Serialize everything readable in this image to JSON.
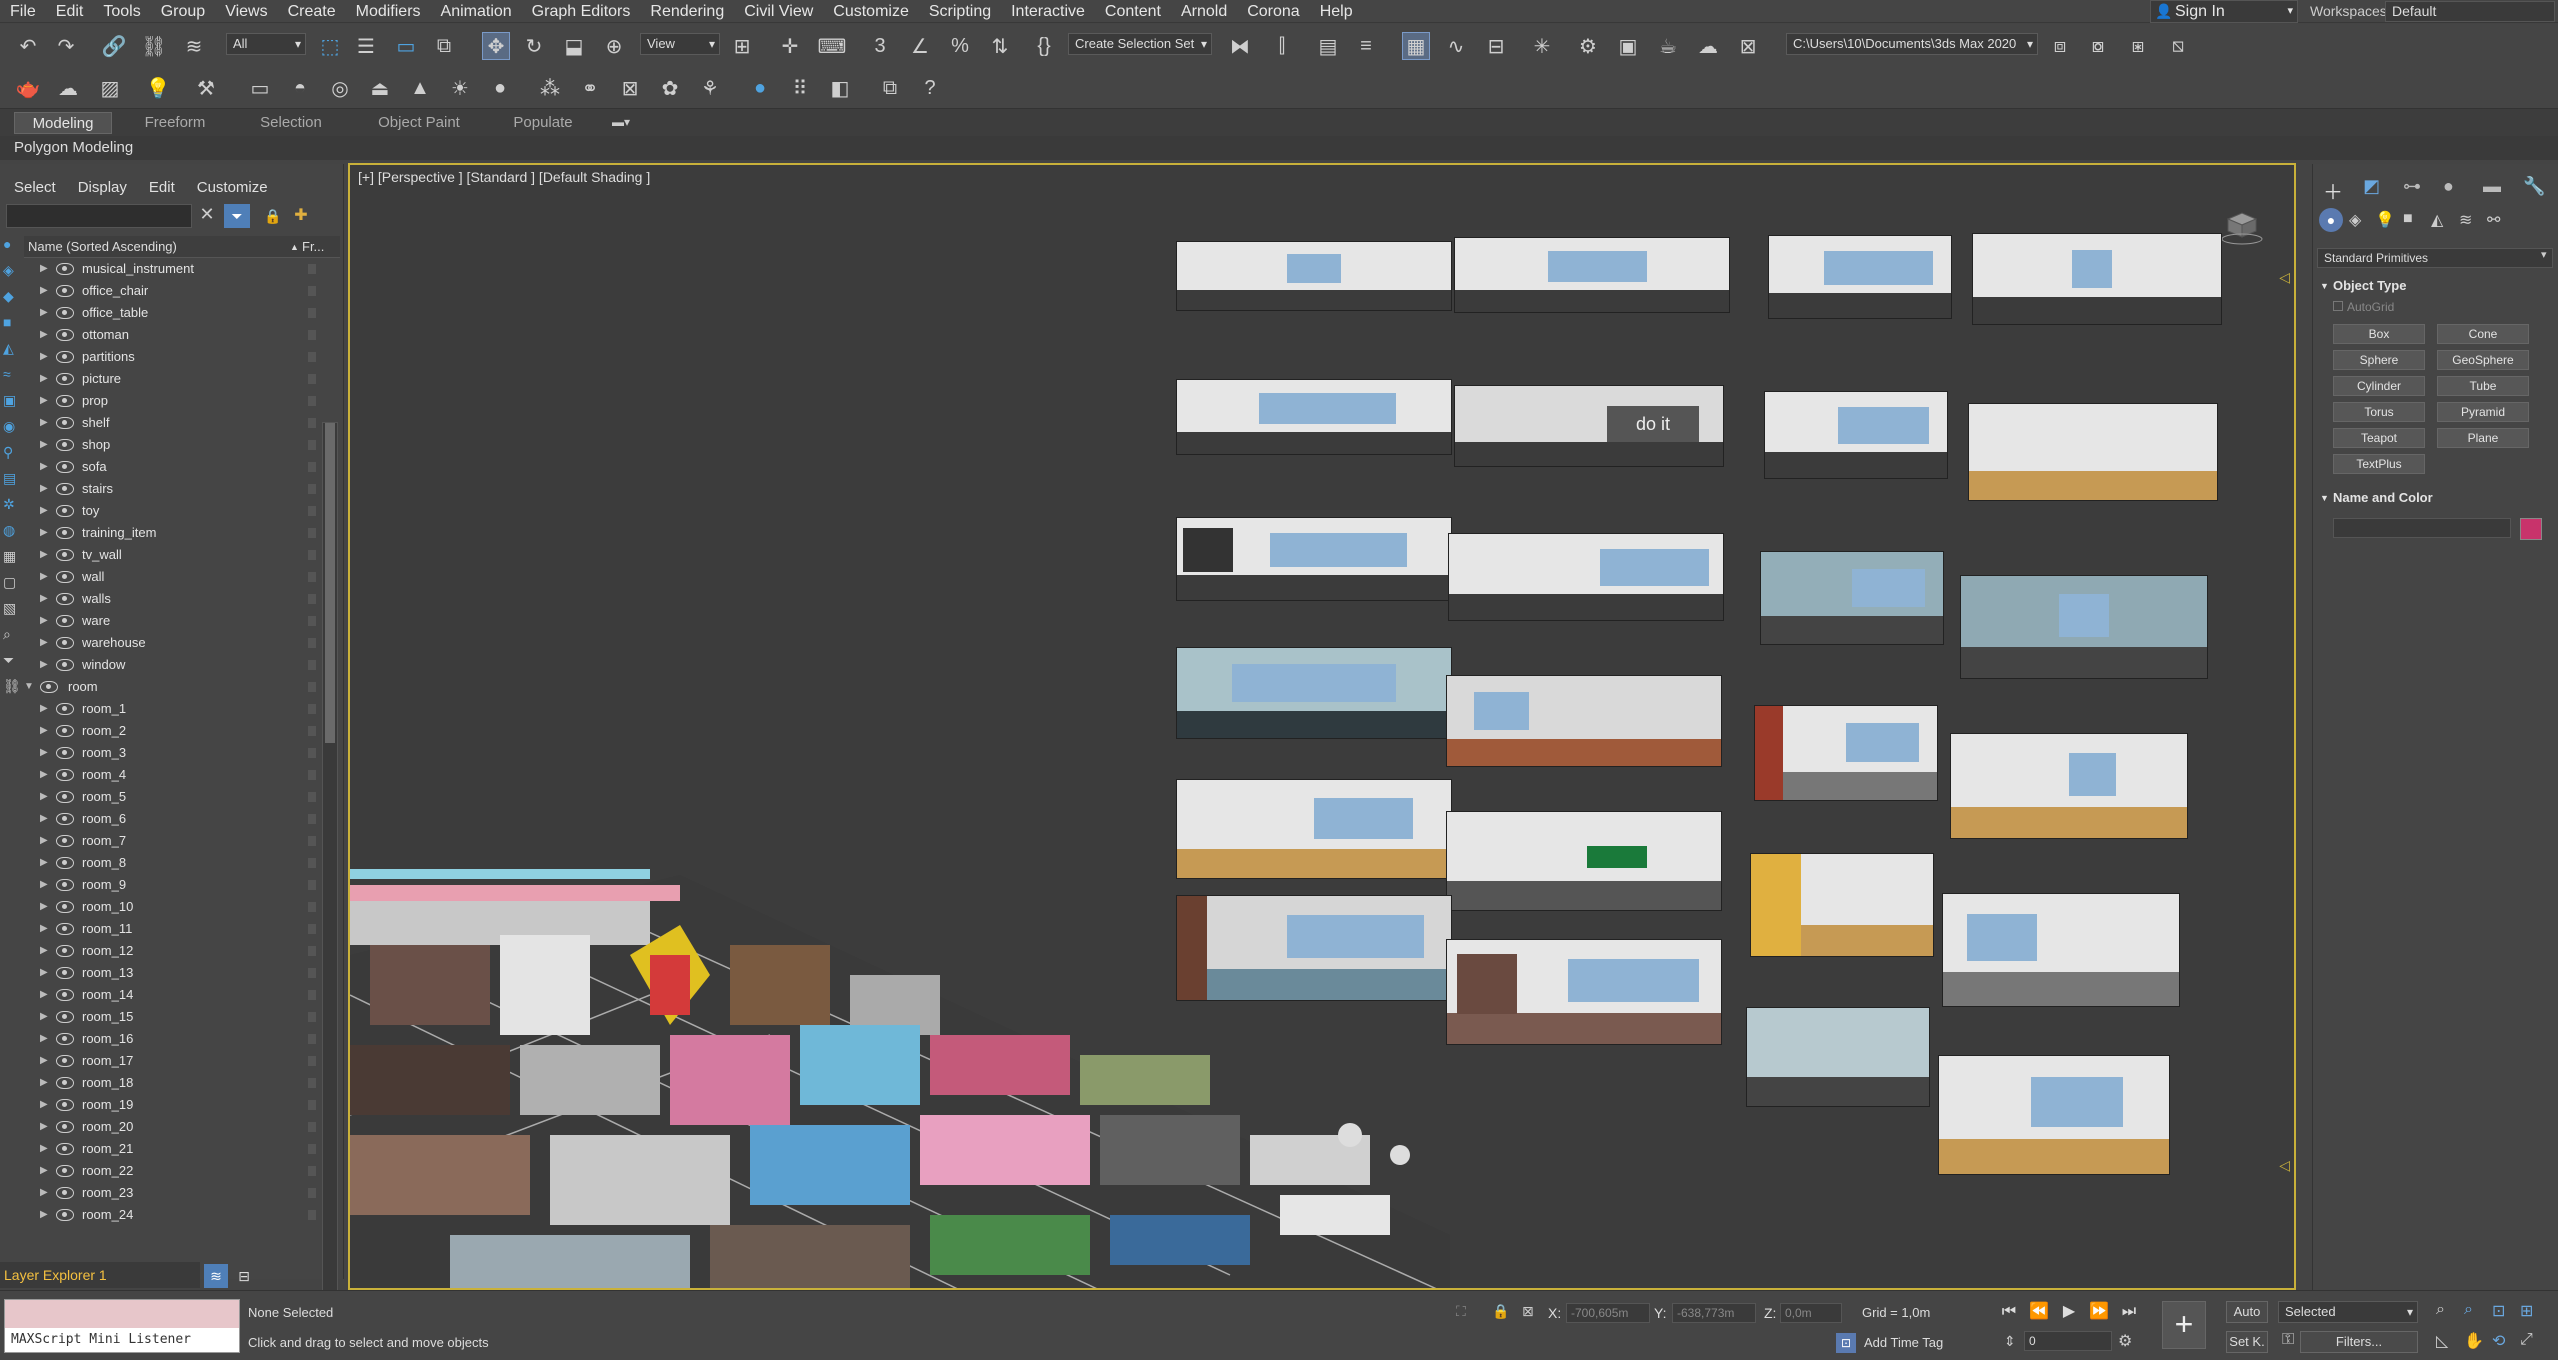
{
  "menu": [
    "File",
    "Edit",
    "Tools",
    "Group",
    "Views",
    "Create",
    "Modifiers",
    "Animation",
    "Graph Editors",
    "Rendering",
    "Civil View",
    "Customize",
    "Scripting",
    "Interactive",
    "Content",
    "Arnold",
    "Corona",
    "Help"
  ],
  "account": {
    "sign_in": "Sign In",
    "workspaces_label": "Workspaces:",
    "workspace": "Default"
  },
  "toolbar": {
    "selection_filter": "All",
    "ref_coord": "View",
    "named_selection": "Create Selection Set",
    "project_path": "C:\\Users\\10\\Documents\\3ds Max 2020"
  },
  "ribbon": {
    "tabs": [
      "Modeling",
      "Freeform",
      "Selection",
      "Object Paint",
      "Populate"
    ],
    "active_tab": "Modeling",
    "panel": "Polygon Modeling"
  },
  "explorer": {
    "menu": [
      "Select",
      "Display",
      "Edit",
      "Customize"
    ],
    "column_name": "Name (Sorted Ascending)",
    "column_frozen": "Fr...",
    "rows": [
      {
        "name": "musical_instrument",
        "level": 1
      },
      {
        "name": "office_chair",
        "level": 1
      },
      {
        "name": "office_table",
        "level": 1
      },
      {
        "name": "ottoman",
        "level": 1
      },
      {
        "name": "partitions",
        "level": 1
      },
      {
        "name": "picture",
        "level": 1
      },
      {
        "name": "prop",
        "level": 1
      },
      {
        "name": "shelf",
        "level": 1
      },
      {
        "name": "shop",
        "level": 1
      },
      {
        "name": "sofa",
        "level": 1
      },
      {
        "name": "stairs",
        "level": 1
      },
      {
        "name": "toy",
        "level": 1
      },
      {
        "name": "training_item",
        "level": 1
      },
      {
        "name": "tv_wall",
        "level": 1
      },
      {
        "name": "wall",
        "level": 1
      },
      {
        "name": "walls",
        "level": 1
      },
      {
        "name": "ware",
        "level": 1
      },
      {
        "name": "warehouse",
        "level": 1
      },
      {
        "name": "window",
        "level": 1
      },
      {
        "name": "room",
        "level": 0
      },
      {
        "name": "room_1",
        "level": 1
      },
      {
        "name": "room_2",
        "level": 1
      },
      {
        "name": "room_3",
        "level": 1
      },
      {
        "name": "room_4",
        "level": 1
      },
      {
        "name": "room_5",
        "level": 1
      },
      {
        "name": "room_6",
        "level": 1
      },
      {
        "name": "room_7",
        "level": 1
      },
      {
        "name": "room_8",
        "level": 1
      },
      {
        "name": "room_9",
        "level": 1
      },
      {
        "name": "room_10",
        "level": 1
      },
      {
        "name": "room_11",
        "level": 1
      },
      {
        "name": "room_12",
        "level": 1
      },
      {
        "name": "room_13",
        "level": 1
      },
      {
        "name": "room_14",
        "level": 1
      },
      {
        "name": "room_15",
        "level": 1
      },
      {
        "name": "room_16",
        "level": 1
      },
      {
        "name": "room_17",
        "level": 1
      },
      {
        "name": "room_18",
        "level": 1
      },
      {
        "name": "room_19",
        "level": 1
      },
      {
        "name": "room_20",
        "level": 1
      },
      {
        "name": "room_21",
        "level": 1
      },
      {
        "name": "room_22",
        "level": 1
      },
      {
        "name": "room_23",
        "level": 1
      },
      {
        "name": "room_24",
        "level": 1
      }
    ],
    "layer_explorer": "Layer Explorer 1"
  },
  "viewport": {
    "label": "[+] [Perspective ] [Standard ] [Default Shading ]",
    "room_sign": "do it"
  },
  "command_panel": {
    "category": "Standard Primitives",
    "object_type_title": "Object Type",
    "autogrid": "AutoGrid",
    "buttons": [
      "Box",
      "Cone",
      "Sphere",
      "GeoSphere",
      "Cylinder",
      "Tube",
      "Torus",
      "Pyramid",
      "Teapot",
      "Plane",
      "TextPlus"
    ],
    "name_color_title": "Name and Color",
    "color": "#c8336b"
  },
  "status": {
    "maxscript": "MAXScript Mini Listener",
    "selection": "None Selected",
    "prompt": "Click and drag to select and move objects",
    "x_label": "X:",
    "x_value": "-700,605m",
    "y_label": "Y:",
    "y_value": "-638,773m",
    "z_label": "Z:",
    "z_value": "0,0m",
    "grid": "Grid = 1,0m",
    "add_time_tag": "Add Time Tag",
    "frame": "0",
    "auto": "Auto",
    "set_key": "Set K.",
    "key_filter": "Selected",
    "filters": "Filters..."
  }
}
